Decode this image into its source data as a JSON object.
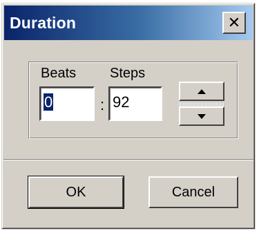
{
  "dialog": {
    "title": "Duration",
    "close_glyph": "✕"
  },
  "fields": {
    "beats_label": "Beats",
    "steps_label": "Steps",
    "beats_value": "0",
    "separator": ":",
    "steps_value": "92"
  },
  "spinner": {
    "up_icon": "arrow-up-icon",
    "down_icon": "arrow-down-icon"
  },
  "buttons": {
    "ok_label": "OK",
    "cancel_label": "Cancel"
  },
  "colors": {
    "title_bar_start": "#0a246a",
    "title_bar_end": "#a6caf0",
    "face": "#d4d0c8",
    "selection": "#0a246a"
  }
}
